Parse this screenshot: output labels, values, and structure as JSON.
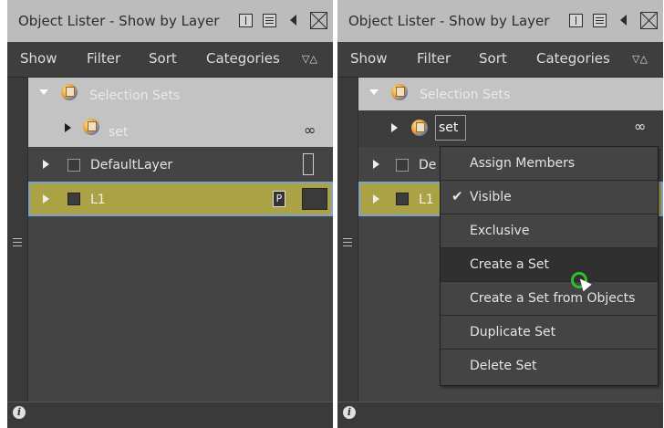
{
  "left": {
    "title": "Object Lister - Show by Layer",
    "menu": {
      "show": "Show",
      "filter": "Filter",
      "sort": "Sort",
      "categories": "Categories",
      "arrows": "▽△"
    },
    "rows": {
      "selection_sets": "Selection Sets",
      "set": "set",
      "default_layer": "DefaultLayer",
      "l1": "L1",
      "l1_badge": "P"
    },
    "link_glyph": "∞",
    "info": "i"
  },
  "right": {
    "title": "Object Lister - Show by Layer",
    "menu": {
      "show": "Show",
      "filter": "Filter",
      "sort": "Sort",
      "categories": "Categories",
      "arrows": "▽△"
    },
    "rows": {
      "selection_sets": "Selection Sets",
      "set": "set",
      "default_layer_partial": "De",
      "l1": "L1"
    },
    "link_glyph": "∞",
    "info": "i"
  },
  "context_menu": {
    "items": [
      {
        "label": "Assign Members",
        "checked": false
      },
      {
        "label": "Visible",
        "checked": true
      },
      {
        "label": "Exclusive",
        "checked": false
      },
      {
        "label": "Create a Set",
        "checked": false,
        "highlighted": true
      },
      {
        "label": "Create a Set from Objects",
        "checked": false
      },
      {
        "label": "Duplicate Set",
        "checked": false
      },
      {
        "label": "Delete Set",
        "checked": false
      }
    ],
    "check_glyph": "✔"
  },
  "colors": {
    "titlebar": "#bcbcbc",
    "panel": "#444444",
    "selection_row": "#c3c3c3",
    "l1_row": "#aaa244",
    "l1_outline": "#7fa3cf",
    "cursor_ring": "#2fbf2f"
  }
}
